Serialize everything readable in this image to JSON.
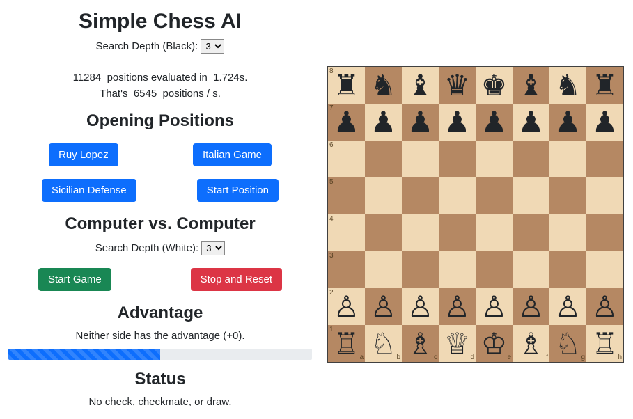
{
  "title": "Simple Chess AI",
  "search_depth_black_label": "Search Depth (Black):",
  "search_depth_black_value": "3",
  "stats": {
    "positions": "11284",
    "positions_word": "positions evaluated in",
    "time": "1.724s.",
    "line2_prefix": "That's",
    "pps": "6545",
    "pps_unit": "positions / s."
  },
  "openings": {
    "heading": "Opening Positions",
    "ruy_lopez": "Ruy Lopez",
    "italian_game": "Italian Game",
    "sicilian_defense": "Sicilian Defense",
    "start_position": "Start Position"
  },
  "cvc": {
    "heading": "Computer vs. Computer",
    "search_depth_white_label": "Search Depth (White):",
    "search_depth_white_value": "3",
    "start_game": "Start Game",
    "stop_reset": "Stop and Reset"
  },
  "advantage": {
    "heading": "Advantage",
    "text": "Neither side has the advantage (+0).",
    "percent": 50
  },
  "status": {
    "heading": "Status",
    "text": "No check, checkmate, or draw."
  },
  "board": {
    "files": [
      "a",
      "b",
      "c",
      "d",
      "e",
      "f",
      "g",
      "h"
    ],
    "ranks": [
      "8",
      "7",
      "6",
      "5",
      "4",
      "3",
      "2",
      "1"
    ],
    "rows": [
      [
        "bR",
        "bN",
        "bB",
        "bQ",
        "bK",
        "bB",
        "bN",
        "bR"
      ],
      [
        "bP",
        "bP",
        "bP",
        "bP",
        "bP",
        "bP",
        "bP",
        "bP"
      ],
      [
        "",
        "",
        "",
        "",
        "",
        "",
        "",
        ""
      ],
      [
        "",
        "",
        "",
        "",
        "",
        "",
        "",
        ""
      ],
      [
        "",
        "",
        "",
        "",
        "",
        "",
        "",
        ""
      ],
      [
        "",
        "",
        "",
        "",
        "",
        "",
        "",
        ""
      ],
      [
        "wP",
        "wP",
        "wP",
        "wP",
        "wP",
        "wP",
        "wP",
        "wP"
      ],
      [
        "wR",
        "wN",
        "wB",
        "wQ",
        "wK",
        "wB",
        "wN",
        "wR"
      ]
    ]
  }
}
